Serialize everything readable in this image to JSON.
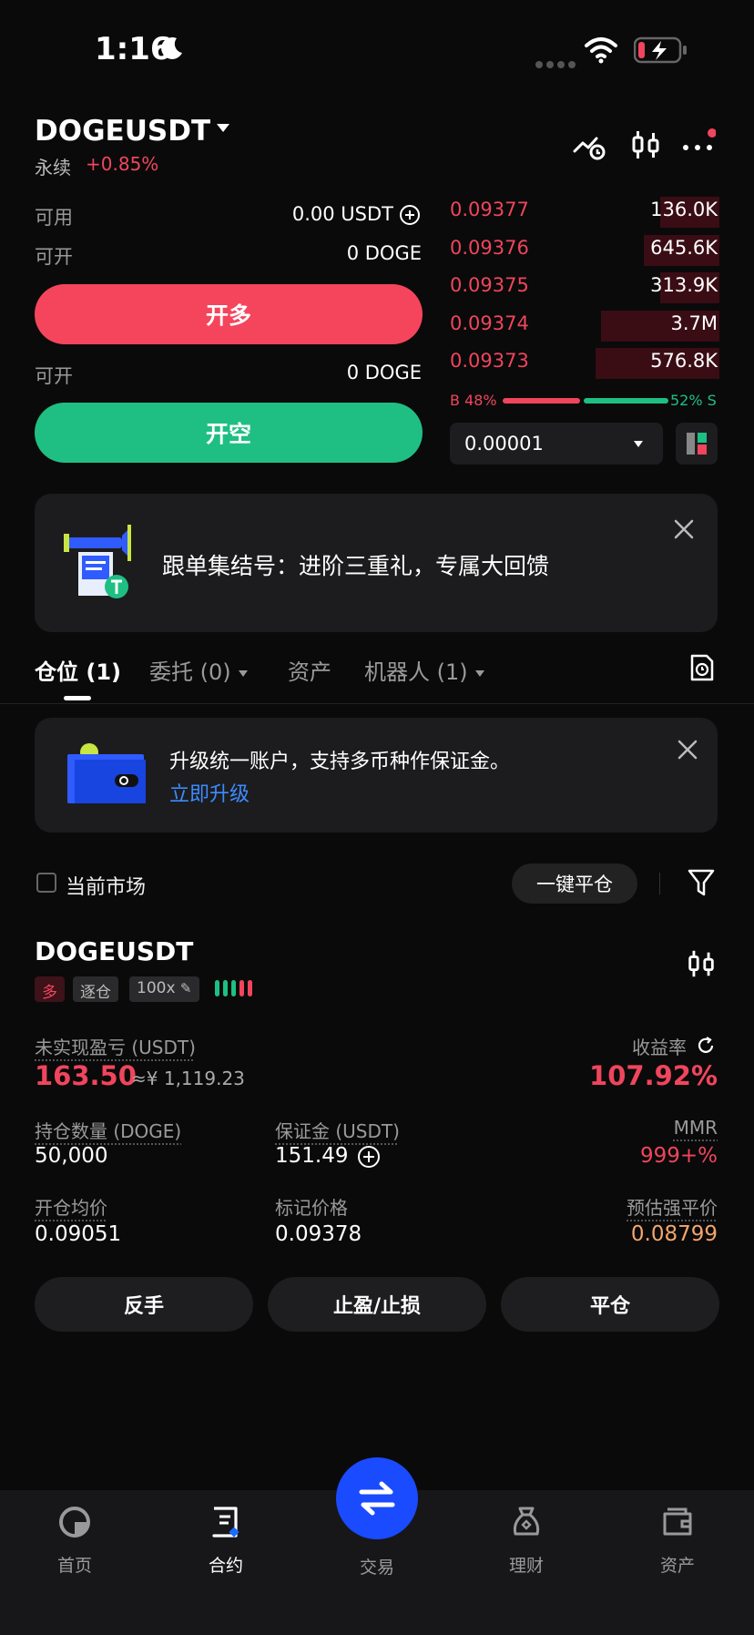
{
  "status_bar": {
    "time": "1:16"
  },
  "header": {
    "pair": "DOGEUSDT",
    "perp_label": "永续",
    "change": "+0.85%"
  },
  "trade_panel": {
    "available_label": "可用",
    "available_value": "0.00 USDT",
    "can_open_label_1": "可开",
    "can_open_value_1": "0 DOGE",
    "long_button": "开多",
    "can_open_label_2": "可开",
    "can_open_value_2": "0 DOGE",
    "short_button": "开空"
  },
  "orderbook": {
    "asks": [
      {
        "price": "0.09377",
        "qty": "136.0K",
        "depth": 0.22
      },
      {
        "price": "0.09376",
        "qty": "645.6K",
        "depth": 0.28
      },
      {
        "price": "0.09375",
        "qty": "313.9K",
        "depth": 0.22
      },
      {
        "price": "0.09374",
        "qty": "3.7M",
        "depth": 0.44
      },
      {
        "price": "0.09373",
        "qty": "576.8K",
        "depth": 0.46
      }
    ],
    "buy_ratio_label": "B 48%",
    "sell_ratio_label": "52% S",
    "buy_ratio": 0.48,
    "sell_ratio": 0.52,
    "precision": "0.00001"
  },
  "banner_promo": {
    "text": "跟单集结号：进阶三重礼，专属大回馈"
  },
  "tabs": [
    {
      "label": "仓位 (1)",
      "active": true
    },
    {
      "label": "委托 (0)",
      "active": false
    },
    {
      "label": "资产",
      "active": false
    },
    {
      "label": "机器人 (1)",
      "active": false
    }
  ],
  "banner_upgrade": {
    "text": "升级统一账户，支持多币种作保证金。",
    "link": "立即升级"
  },
  "filters": {
    "current_market": "当前市场",
    "close_all": "一键平仓"
  },
  "position": {
    "symbol": "DOGEUSDT",
    "side_tag": "多",
    "margin_tag": "逐仓",
    "leverage_tag": "100x",
    "unrealized_label": "未实现盈亏 (USDT)",
    "unrealized_value": "163.50",
    "unrealized_cny": "≈¥ 1,119.23",
    "roi_label": "收益率",
    "roi_value": "107.92%",
    "size_label": "持仓数量 (DOGE)",
    "size_value": "50,000",
    "margin_label": "保证金 (USDT)",
    "margin_value": "151.49",
    "mmr_label": "MMR",
    "mmr_value": "999+%",
    "entry_label": "开仓均价",
    "entry_value": "0.09051",
    "mark_label": "标记价格",
    "mark_value": "0.09378",
    "liq_label": "预估强平价",
    "liq_value": "0.08799",
    "btn_reverse": "反手",
    "btn_tpsl": "止盈/止损",
    "btn_close": "平仓"
  },
  "bottom_nav": {
    "home": "首页",
    "contract": "合约",
    "trade": "交易",
    "finance": "理财",
    "assets": "资产"
  },
  "colors": {
    "red": "#f0455c",
    "green": "#1fbf83",
    "blue": "#1a4bff",
    "liq": "#f5a56a"
  }
}
